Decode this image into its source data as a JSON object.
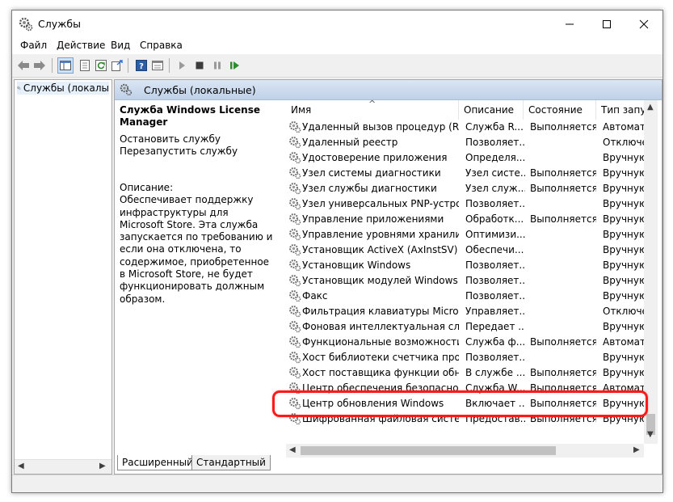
{
  "window": {
    "title": "Службы"
  },
  "menu": {
    "file": "Файл",
    "action": "Действие",
    "view": "Вид",
    "help": "Справка"
  },
  "tree": {
    "root": "Службы (локалы"
  },
  "panel": {
    "title": "Службы (локальные)"
  },
  "details": {
    "service_name": "Служба Windows License Manager",
    "stop_link": "Остановить",
    "stop_suffix": " службу",
    "restart_link": "Перезапустить",
    "restart_suffix": " службу",
    "description_label": "Описание:",
    "description_text": "Обеспечивает поддержку инфраструктуры для Microsoft Store. Эта служба запускается по требованию и если она отключена, то содержимое, приобретенное в Microsoft Store, не будет функционировать должным образом."
  },
  "columns": {
    "name": "Имя",
    "desc": "Описание",
    "state": "Состояние",
    "type": "Тип запус"
  },
  "rows": [
    {
      "name": "Удаленный вызов процедур (RPC)",
      "desc": "Служба R...",
      "state": "Выполняется",
      "type": "Автомати"
    },
    {
      "name": "Удаленный реестр",
      "desc": "Позволяет...",
      "state": "",
      "type": "Отключен"
    },
    {
      "name": "Удостоверение приложения",
      "desc": "Определя...",
      "state": "",
      "type": "Вручную"
    },
    {
      "name": "Узел системы диагностики",
      "desc": "Узел систе...",
      "state": "Выполняется",
      "type": "Вручную"
    },
    {
      "name": "Узел службы диагностики",
      "desc": "Узел служ...",
      "state": "Выполняется",
      "type": "Вручную"
    },
    {
      "name": "Узел универсальных PNP-устро...",
      "desc": "Позволяет...",
      "state": "",
      "type": "Вручную"
    },
    {
      "name": "Управление приложениями",
      "desc": "Обработк...",
      "state": "Выполняется",
      "type": "Вручную"
    },
    {
      "name": "Управление уровнями хранилища",
      "desc": "Оптимизи...",
      "state": "",
      "type": "Вручную"
    },
    {
      "name": "Установщик ActiveX (AxInstSV)",
      "desc": "Обеспечи...",
      "state": "",
      "type": "Вручную"
    },
    {
      "name": "Установщик Windows",
      "desc": "Позволяет...",
      "state": "",
      "type": "Вручную"
    },
    {
      "name": "Установщик модулей Windows",
      "desc": "Позволяет...",
      "state": "",
      "type": "Вручную"
    },
    {
      "name": "Факс",
      "desc": "Позволяет...",
      "state": "",
      "type": "Вручную"
    },
    {
      "name": "Фильтрация клавиатуры Microsoft",
      "desc": "Управляет...",
      "state": "",
      "type": "Отключен"
    },
    {
      "name": "Фоновая интеллектуальная служ...",
      "desc": "Передает ...",
      "state": "",
      "type": "Вручную"
    },
    {
      "name": "Функциональные возможности ...",
      "desc": "Служба ф...",
      "state": "Выполняется",
      "type": "Автомати"
    },
    {
      "name": "Хост библиотеки счетчика прои...",
      "desc": "Позволяет...",
      "state": "",
      "type": "Вручную"
    },
    {
      "name": "Хост поставщика функции обна...",
      "desc": "В службе ...",
      "state": "Выполняется",
      "type": "Вручную"
    },
    {
      "name": "Центр обеспечения безопасности",
      "desc": "Служба W...",
      "state": "Выполняется",
      "type": "Автомати"
    },
    {
      "name": "Центр обновления Windows",
      "desc": "Включает ...",
      "state": "Выполняется",
      "type": "Вручную"
    },
    {
      "name": "Шифрованная файловая систем...",
      "desc": "Предостав...",
      "state": "Выполняется",
      "type": "Вручную"
    }
  ],
  "tabs": {
    "extended": "Расширенный",
    "standard": "Стандартный"
  },
  "colors": {
    "highlight": "#ff1a1a",
    "link": "#0066cc",
    "header_gradient": "#bfd0e8"
  }
}
